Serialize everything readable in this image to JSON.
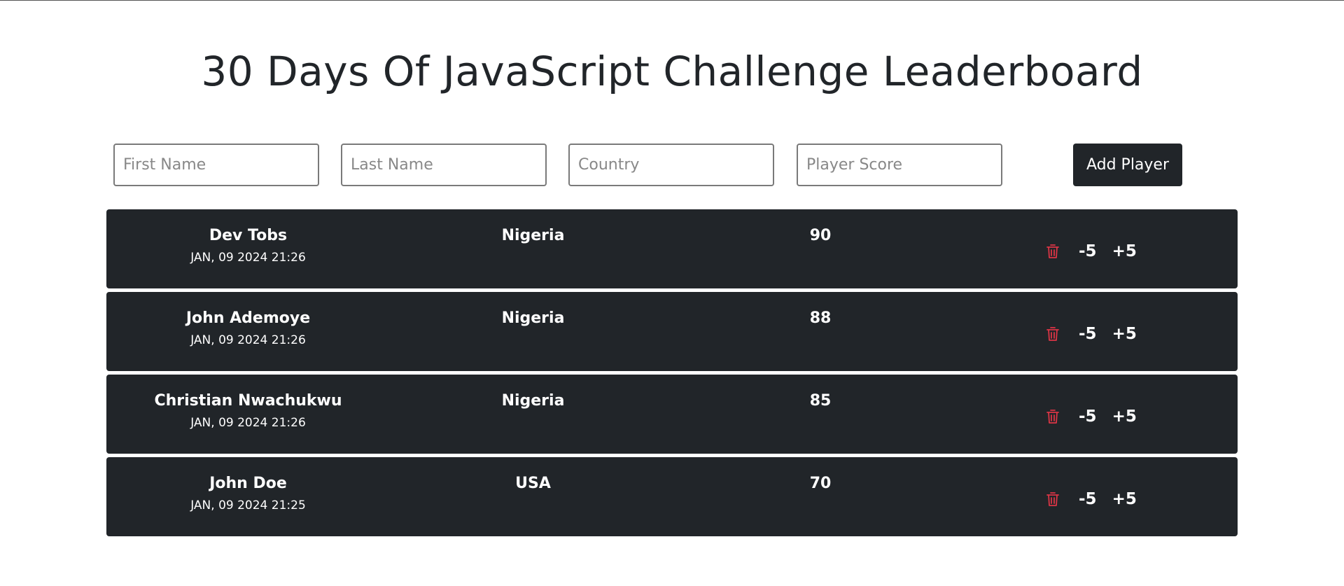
{
  "page": {
    "title": "30 Days Of JavaScript Challenge Leaderboard"
  },
  "form": {
    "first_name_placeholder": "First Name",
    "last_name_placeholder": "Last Name",
    "country_placeholder": "Country",
    "score_placeholder": "Player Score",
    "add_button_label": "Add Player"
  },
  "actions": {
    "delete_icon": "trash-icon",
    "minus_label": "-5",
    "plus_label": "+5"
  },
  "colors": {
    "row_background": "#212529",
    "delete_icon": "#dc3545",
    "button_background": "#212529"
  },
  "players": [
    {
      "name": "Dev Tobs",
      "date": "JAN, 09 2024 21:26",
      "country": "Nigeria",
      "score": "90"
    },
    {
      "name": "John Ademoye",
      "date": "JAN, 09 2024 21:26",
      "country": "Nigeria",
      "score": "88"
    },
    {
      "name": "Christian Nwachukwu",
      "date": "JAN, 09 2024 21:26",
      "country": "Nigeria",
      "score": "85"
    },
    {
      "name": "John Doe",
      "date": "JAN, 09 2024 21:25",
      "country": "USA",
      "score": "70"
    }
  ]
}
